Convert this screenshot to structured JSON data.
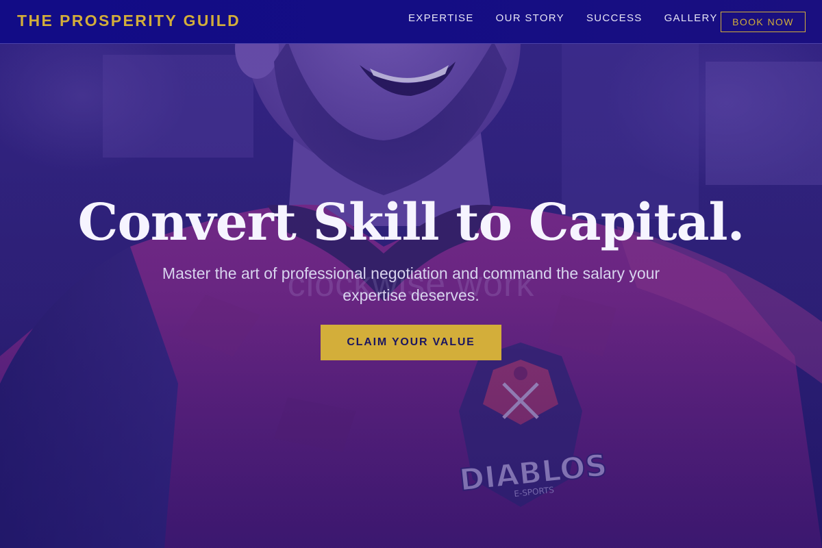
{
  "brand": {
    "name": "THE PROSPERITY GUILD",
    "color": "#d3ae3a"
  },
  "nav": {
    "links": [
      {
        "label": "EXPERTISE"
      },
      {
        "label": "OUR STORY"
      },
      {
        "label": "SUCCESS"
      },
      {
        "label": "GALLERY"
      }
    ],
    "book_label": "BOOK NOW"
  },
  "hero": {
    "title": "Convert Skill to Capital.",
    "subtitle": "Master the art of professional negotiation and command the salary your expertise deserves.",
    "cta_label": "CLAIM YOUR VALUE",
    "background_watermark": "clockwise work",
    "jersey_logo_text": "DIABLOS",
    "jersey_logo_subtext": "E-SPORTS"
  },
  "colors": {
    "nav_background": "#140d84",
    "accent_gold": "#d3ae3a",
    "overlay": "#231678",
    "title_text": "#f6f4ff"
  }
}
